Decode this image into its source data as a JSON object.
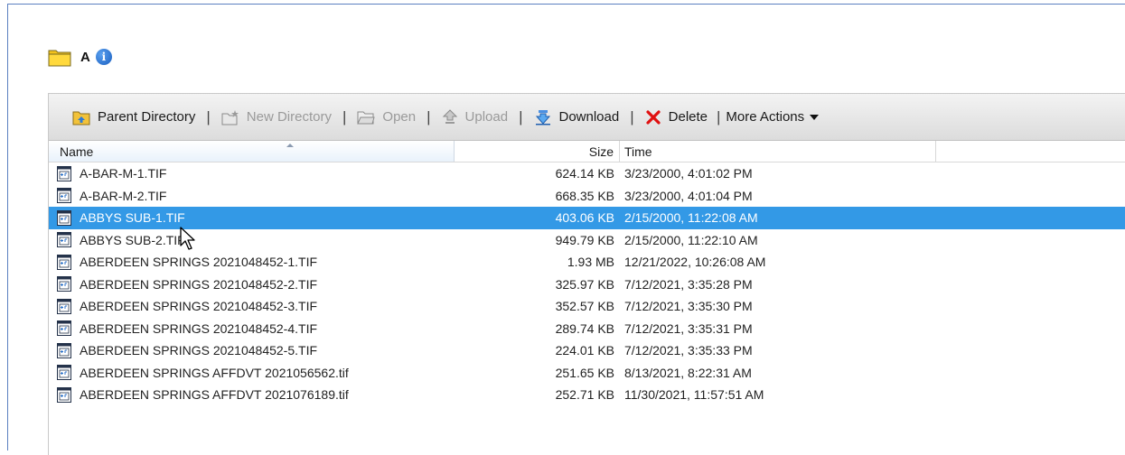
{
  "folder": {
    "title": "A",
    "icon": "folder-icon",
    "info_icon": "info-icon"
  },
  "toolbar": {
    "parent_directory": "Parent Directory",
    "new_directory": "New Directory",
    "open": "Open",
    "upload": "Upload",
    "download": "Download",
    "delete": "Delete",
    "more_actions": "More Actions",
    "separator": "|"
  },
  "columns": {
    "name": "Name",
    "size": "Size",
    "time": "Time"
  },
  "files": [
    {
      "name": "A-BAR-M-1.TIF",
      "size": "624.14 KB",
      "time": "3/23/2000, 4:01:02 PM",
      "selected": false
    },
    {
      "name": "A-BAR-M-2.TIF",
      "size": "668.35 KB",
      "time": "3/23/2000, 4:01:04 PM",
      "selected": false
    },
    {
      "name": "ABBYS SUB-1.TIF",
      "size": "403.06 KB",
      "time": "2/15/2000, 11:22:08 AM",
      "selected": true
    },
    {
      "name": "ABBYS SUB-2.TIF",
      "size": "949.79 KB",
      "time": "2/15/2000, 11:22:10 AM",
      "selected": false
    },
    {
      "name": "ABERDEEN SPRINGS 2021048452-1.TIF",
      "size": "1.93 MB",
      "time": "12/21/2022, 10:26:08 AM",
      "selected": false
    },
    {
      "name": "ABERDEEN SPRINGS 2021048452-2.TIF",
      "size": "325.97 KB",
      "time": "7/12/2021, 3:35:28 PM",
      "selected": false
    },
    {
      "name": "ABERDEEN SPRINGS 2021048452-3.TIF",
      "size": "352.57 KB",
      "time": "7/12/2021, 3:35:30 PM",
      "selected": false
    },
    {
      "name": "ABERDEEN SPRINGS 2021048452-4.TIF",
      "size": "289.74 KB",
      "time": "7/12/2021, 3:35:31 PM",
      "selected": false
    },
    {
      "name": "ABERDEEN SPRINGS 2021048452-5.TIF",
      "size": "224.01 KB",
      "time": "7/12/2021, 3:35:33 PM",
      "selected": false
    },
    {
      "name": "ABERDEEN SPRINGS AFFDVT 2021056562.tif",
      "size": "251.65 KB",
      "time": "8/13/2021, 8:22:31 AM",
      "selected": false
    },
    {
      "name": "ABERDEEN SPRINGS AFFDVT 2021076189.tif",
      "size": "252.71 KB",
      "time": "11/30/2021, 11:57:51 AM",
      "selected": false
    }
  ],
  "colors": {
    "selection": "#3399e6",
    "frame_border": "#5b80c0",
    "delete_red": "#e01010",
    "download_blue": "#1f6fd0"
  }
}
